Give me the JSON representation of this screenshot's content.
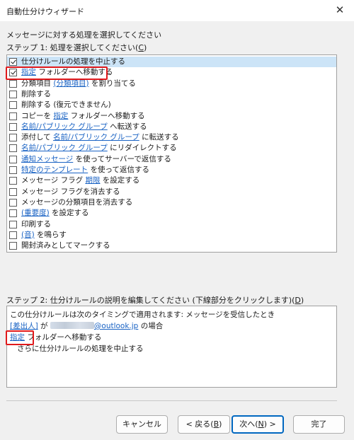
{
  "window": {
    "title": "自動仕分けウィザード",
    "close_glyph": "✕"
  },
  "prompt": "メッセージに対する処理を選択してください",
  "step1": {
    "label_prefix": "ステップ 1: 処理を選択してください(",
    "label_key": "C",
    "label_suffix": ")"
  },
  "actions": [
    {
      "checked": true,
      "selected": true,
      "parts": [
        {
          "t": "仕分けルールの処理を中止する",
          "link": false
        }
      ]
    },
    {
      "checked": true,
      "selected": false,
      "parts": [
        {
          "t": "指定",
          "link": true
        },
        {
          "t": " フォルダーへ移動する",
          "link": false
        }
      ]
    },
    {
      "checked": false,
      "selected": false,
      "parts": [
        {
          "t": "分類項目 ",
          "link": false
        },
        {
          "t": "(分類項目)",
          "link": true
        },
        {
          "t": " を割り当てる",
          "link": false
        }
      ]
    },
    {
      "checked": false,
      "selected": false,
      "parts": [
        {
          "t": "削除する",
          "link": false
        }
      ]
    },
    {
      "checked": false,
      "selected": false,
      "parts": [
        {
          "t": "削除する (復元できません)",
          "link": false
        }
      ]
    },
    {
      "checked": false,
      "selected": false,
      "parts": [
        {
          "t": "コピーを ",
          "link": false
        },
        {
          "t": "指定",
          "link": true
        },
        {
          "t": " フォルダーへ移動する",
          "link": false
        }
      ]
    },
    {
      "checked": false,
      "selected": false,
      "parts": [
        {
          "t": "名前/パブリック グループ",
          "link": true
        },
        {
          "t": " へ転送する",
          "link": false
        }
      ]
    },
    {
      "checked": false,
      "selected": false,
      "parts": [
        {
          "t": "添付して ",
          "link": false
        },
        {
          "t": "名前/パブリック グループ",
          "link": true
        },
        {
          "t": " に転送する",
          "link": false
        }
      ]
    },
    {
      "checked": false,
      "selected": false,
      "parts": [
        {
          "t": "名前/パブリック グループ",
          "link": true
        },
        {
          "t": " にリダイレクトする",
          "link": false
        }
      ]
    },
    {
      "checked": false,
      "selected": false,
      "parts": [
        {
          "t": "通知メッセージ",
          "link": true
        },
        {
          "t": " を使ってサーバーで返信する",
          "link": false
        }
      ]
    },
    {
      "checked": false,
      "selected": false,
      "parts": [
        {
          "t": "特定のテンプレート",
          "link": true
        },
        {
          "t": " を使って返信する",
          "link": false
        }
      ]
    },
    {
      "checked": false,
      "selected": false,
      "parts": [
        {
          "t": "メッセージ フラグ ",
          "link": false
        },
        {
          "t": "期限",
          "link": true
        },
        {
          "t": " を設定する",
          "link": false
        }
      ]
    },
    {
      "checked": false,
      "selected": false,
      "parts": [
        {
          "t": "メッセージ フラグを消去する",
          "link": false
        }
      ]
    },
    {
      "checked": false,
      "selected": false,
      "parts": [
        {
          "t": "メッセージの分類項目を消去する",
          "link": false
        }
      ]
    },
    {
      "checked": false,
      "selected": false,
      "parts": [
        {
          "t": "(重要度)",
          "link": true
        },
        {
          "t": " を設定する",
          "link": false
        }
      ]
    },
    {
      "checked": false,
      "selected": false,
      "parts": [
        {
          "t": "印刷する",
          "link": false
        }
      ]
    },
    {
      "checked": false,
      "selected": false,
      "parts": [
        {
          "t": "(音)",
          "link": true
        },
        {
          "t": " を鳴らす",
          "link": false
        }
      ]
    },
    {
      "checked": false,
      "selected": false,
      "parts": [
        {
          "t": "開封済みとしてマークする",
          "link": false
        }
      ]
    }
  ],
  "step2": {
    "label_prefix": "ステップ 2: 仕分けルールの説明を編集してください (下線部分をクリックします)(",
    "label_key": "D",
    "label_suffix": ")"
  },
  "description": {
    "line1": "この仕分けルールは次のタイミングで適用されます: メッセージを受信したとき",
    "line2_link": "[差出人]",
    "line2_mid": " が ",
    "line2_email_domain": "@outlook.jp",
    "line2_end": " の場合",
    "line3_link": "指定",
    "line3_rest": " フォルダーへ移動する",
    "line4": "さらに仕分けルールの処理を中止する"
  },
  "buttons": {
    "cancel": "キャンセル",
    "back_prefix": "< 戻る(",
    "back_key": "B",
    "back_suffix": ")",
    "next_prefix": "次へ(",
    "next_key": "N",
    "next_suffix": ") >",
    "finish": "完了"
  },
  "colors": {
    "link": "#1a63c4",
    "selected_row": "#cce4f7",
    "highlight": "#e0191b",
    "default_button_border": "#0067c0"
  }
}
